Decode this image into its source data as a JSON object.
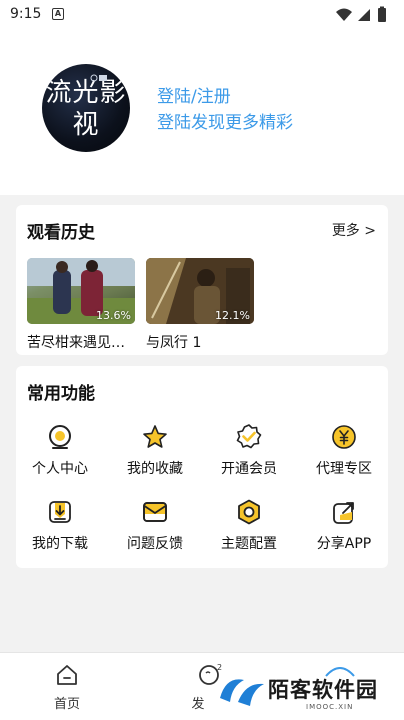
{
  "status_bar": {
    "time": "9:15",
    "notification_letter": "A"
  },
  "profile": {
    "avatar_text": "流光影视",
    "login_title": "登陆/注册",
    "login_subtitle": "登陆发现更多精彩"
  },
  "history": {
    "title": "观看历史",
    "more": "更多 >",
    "items": [
      {
        "title": "苦尽柑来遇见…",
        "progress": "13.6%"
      },
      {
        "title": "与凤行 1",
        "progress": "12.1%"
      }
    ]
  },
  "functions": {
    "title": "常用功能",
    "items": [
      {
        "label": "个人中心",
        "icon": "person-center-icon"
      },
      {
        "label": "我的收藏",
        "icon": "star-icon"
      },
      {
        "label": "开通会员",
        "icon": "vip-badge-icon"
      },
      {
        "label": "代理专区",
        "icon": "yuan-icon"
      },
      {
        "label": "我的下载",
        "icon": "download-icon"
      },
      {
        "label": "问题反馈",
        "icon": "feedback-mail-icon"
      },
      {
        "label": "主题配置",
        "icon": "theme-hexagon-icon"
      },
      {
        "label": "分享APP",
        "icon": "share-icon"
      }
    ]
  },
  "tabbar": {
    "tabs": [
      {
        "label": "首页",
        "icon": "home-icon"
      },
      {
        "label": "发",
        "icon": "discover-icon"
      }
    ]
  },
  "watermark": {
    "text": "陌客软件园",
    "sub": "IMOOC.XIN"
  },
  "colors": {
    "accent_blue": "#3c9ae8",
    "icon_yellow": "#f6c42a",
    "background": "#f2f2f2"
  }
}
